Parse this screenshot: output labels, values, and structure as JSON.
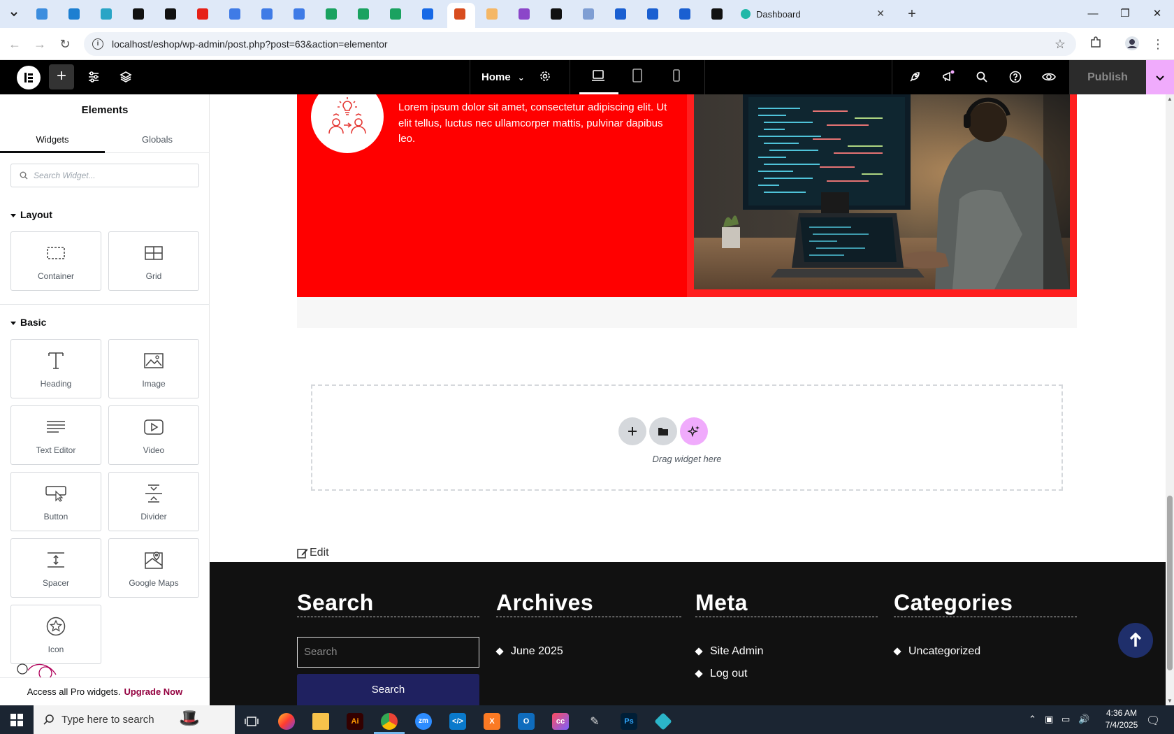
{
  "browser": {
    "tabs_pinned_count": 22,
    "active_tab_title": "Dashboard",
    "url": "localhost/eshop/wp-admin/post.php?post=63&action=elementor",
    "new_tab_label": "+",
    "window_controls": {
      "minimize": "—",
      "restore": "❐",
      "close": "✕"
    }
  },
  "elementor_top": {
    "page_selector": "Home",
    "publish_label": "Publish",
    "icons": [
      "elementor-logo-icon",
      "add-element-icon",
      "site-settings-icon",
      "structure-layers-icon",
      "page-settings-gear-icon",
      "desktop-icon",
      "tablet-icon",
      "mobile-icon",
      "rocket-icon",
      "notifications-megaphone-icon",
      "finder-search-icon",
      "help-icon",
      "preview-eye-icon",
      "chevron-down-icon"
    ],
    "accent_color": "#f0abfc"
  },
  "panel": {
    "title": "Elements",
    "tabs": [
      "Widgets",
      "Globals"
    ],
    "active_tab": "Widgets",
    "search_placeholder": "Search Widget...",
    "sections": [
      {
        "title": "Layout",
        "widgets": [
          "Container",
          "Grid"
        ]
      },
      {
        "title": "Basic",
        "widgets": [
          "Heading",
          "Image",
          "Text Editor",
          "Video",
          "Button",
          "Divider",
          "Spacer",
          "Google Maps",
          "Icon"
        ]
      }
    ],
    "pro_text": "Access all Pro widgets.",
    "pro_link": "Upgrade Now"
  },
  "canvas": {
    "feature_text": "Lorem ipsum dolor sit amet, consectetur adipiscing elit. Ut elit tellus, luctus nec ullamcorper mattis, pulvinar dapibus leo.",
    "feature_bg": "#ff0000",
    "drop_zone_text": "Drag widget here",
    "edit_link": "Edit",
    "footer": {
      "search": {
        "title": "Search",
        "placeholder": "Search",
        "button": "Search"
      },
      "archives": {
        "title": "Archives",
        "items": [
          "June 2025"
        ]
      },
      "meta": {
        "title": "Meta",
        "items": [
          "Site Admin",
          "Log out"
        ]
      },
      "categories": {
        "title": "Categories",
        "items": [
          "Uncategorized"
        ]
      }
    }
  },
  "taskbar": {
    "search_placeholder": "Type here to search",
    "time": "4:36 AM",
    "date": "7/4/2025"
  }
}
